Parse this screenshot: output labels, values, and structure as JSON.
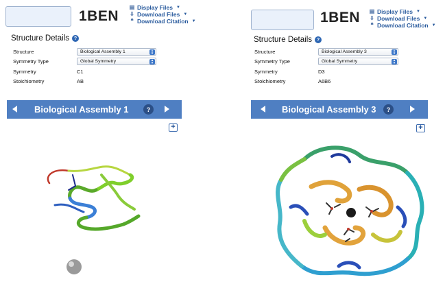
{
  "left": {
    "pdb_id": "1BEN",
    "file_menu": [
      {
        "icon": "display-files-icon",
        "label": "Display Files"
      },
      {
        "icon": "download-files-icon",
        "label": "Download Files"
      },
      {
        "icon": "download-citation-icon",
        "label": "Download Citation"
      }
    ],
    "details_title": "Structure Details",
    "details": {
      "structure_label": "Structure",
      "structure_value": "Biological Assembly 1",
      "symmetry_type_label": "Symmetry Type",
      "symmetry_type_value": "Global Symmetry",
      "symmetry_label": "Symmetry",
      "symmetry_value": "C1",
      "stoichiometry_label": "Stoichiometry",
      "stoichiometry_value": "AB"
    },
    "assembly_title": "Biological Assembly 1",
    "help_glyph": "?",
    "expand_glyph": "+"
  },
  "right": {
    "pdb_id": "1BEN",
    "file_menu": [
      {
        "icon": "display-files-icon",
        "label": "Display Files"
      },
      {
        "icon": "download-files-icon",
        "label": "Download Files"
      },
      {
        "icon": "download-citation-icon",
        "label": "Download Citation"
      }
    ],
    "details_title": "Structure Details",
    "details": {
      "structure_label": "Structure",
      "structure_value": "Biological Assembly 3",
      "symmetry_type_label": "Symmetry Type",
      "symmetry_type_value": "Global Symmetry",
      "symmetry_label": "Symmetry",
      "symmetry_value": "D3",
      "stoichiometry_label": "Stoichiometry",
      "stoichiometry_value": "A6B6"
    },
    "assembly_title": "Biological Assembly 3",
    "help_glyph": "?",
    "expand_glyph": "+"
  },
  "colors": {
    "accent": "#4f7fc2",
    "link": "#2b5c9e",
    "help": "#2d66b3"
  }
}
